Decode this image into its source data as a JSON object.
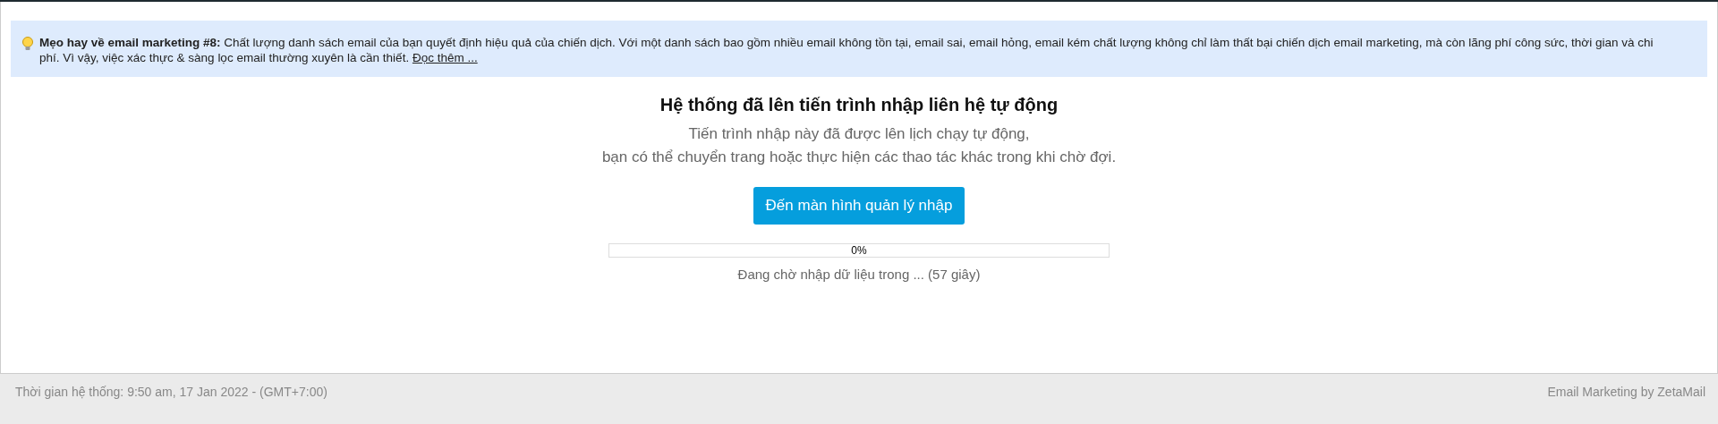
{
  "tip": {
    "text": "**Mẹo hay về email marketing #8:** Chất lượng danh sách email của bạn quyết định hiệu quả của chiến dịch. Với một danh sách bao gồm nhiều email không tồn tại, email sai, email hỏng, email kém chất lượng không chỉ làm thất bại chiến dịch email marketing, mà còn lãng phí công sức, thời gian và chi phí. Vì vậy, việc xác thực & sàng lọc email thường xuyên là cần thiết.",
    "link": "Đọc thêm ..."
  },
  "title": "Hệ thống đã lên tiến trình nhập liên hệ tự động",
  "subtitle_lines": [
    "Tiến trình nhập này đã được lên lịch chạy tự động,",
    "bạn có thể chuyển trang hoặc thực hiện các thao tác khác trong khi chờ đợi."
  ],
  "button": "Đến màn hình quản lý nhập",
  "progress": {
    "level": 0,
    "label": "0%"
  },
  "status": "Đang chờ nhập dữ liệu trong ... (57 giây)",
  "footer": {
    "left": "Thời gian hệ thống: 9:50 am, 17 Jan 2022 - (GMT+7:00)",
    "right": "Email Marketing by ZetaMail"
  }
}
